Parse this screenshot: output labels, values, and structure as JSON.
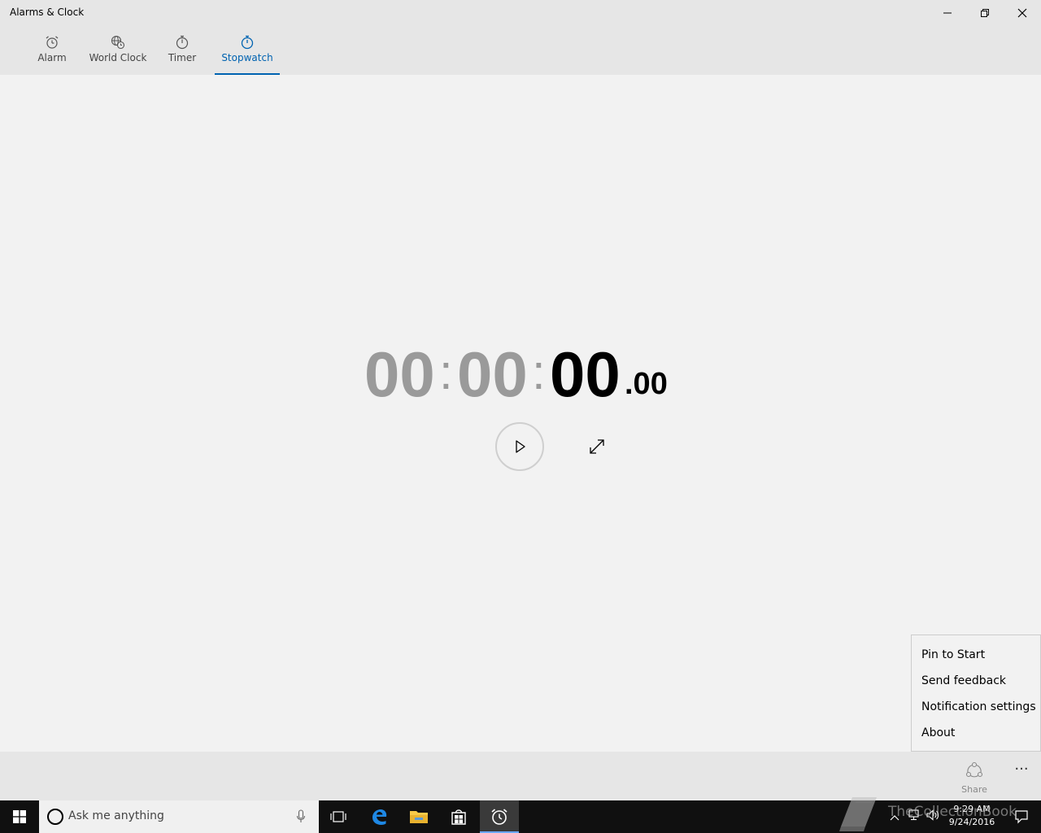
{
  "window": {
    "title": "Alarms & Clock"
  },
  "tabs": [
    {
      "label": "Alarm",
      "icon": "alarm-clock-icon"
    },
    {
      "label": "World Clock",
      "icon": "globe-clock-icon"
    },
    {
      "label": "Timer",
      "icon": "timer-icon"
    },
    {
      "label": "Stopwatch",
      "icon": "stopwatch-icon",
      "active": true
    }
  ],
  "stopwatch": {
    "hours": "00",
    "minutes": "00",
    "seconds": "00",
    "separator": ":",
    "fraction": ".00"
  },
  "menu": {
    "items": [
      "Pin to Start",
      "Send feedback",
      "Notification settings",
      "About"
    ]
  },
  "command_bar": {
    "share_label": "Share",
    "more_label": "···"
  },
  "taskbar": {
    "search_placeholder": "Ask me anything",
    "time": "9:29 AM",
    "date": "9/24/2016"
  },
  "watermark": {
    "text": "TheCollectionBook"
  },
  "colors": {
    "accent": "#0063b1",
    "background": "#f2f2f2",
    "chrome": "#e6e6e6",
    "taskbar": "#101010",
    "dim_digits": "#9a9a9a"
  }
}
